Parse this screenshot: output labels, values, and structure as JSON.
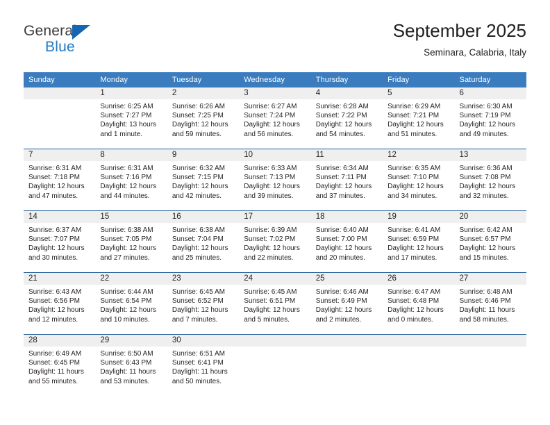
{
  "brand": {
    "name_part1": "General",
    "name_part2": "Blue",
    "accent_color": "#1f7ac4",
    "triangle_color": "#1565b0"
  },
  "header": {
    "title": "September 2025",
    "subtitle": "Seminara, Calabria, Italy"
  },
  "theme": {
    "header_band": "#3a7cbe",
    "row_divider": "#1f5c99",
    "daynum_band": "#efefef",
    "text": "#231f20"
  },
  "weekday_headers": [
    "Sunday",
    "Monday",
    "Tuesday",
    "Wednesday",
    "Thursday",
    "Friday",
    "Saturday"
  ],
  "weeks": [
    [
      {
        "day": "",
        "sunrise": "",
        "sunset": "",
        "daylight_line1": "",
        "daylight_line2": ""
      },
      {
        "day": "1",
        "sunrise": "Sunrise: 6:25 AM",
        "sunset": "Sunset: 7:27 PM",
        "daylight_line1": "Daylight: 13 hours",
        "daylight_line2": "and 1 minute."
      },
      {
        "day": "2",
        "sunrise": "Sunrise: 6:26 AM",
        "sunset": "Sunset: 7:25 PM",
        "daylight_line1": "Daylight: 12 hours",
        "daylight_line2": "and 59 minutes."
      },
      {
        "day": "3",
        "sunrise": "Sunrise: 6:27 AM",
        "sunset": "Sunset: 7:24 PM",
        "daylight_line1": "Daylight: 12 hours",
        "daylight_line2": "and 56 minutes."
      },
      {
        "day": "4",
        "sunrise": "Sunrise: 6:28 AM",
        "sunset": "Sunset: 7:22 PM",
        "daylight_line1": "Daylight: 12 hours",
        "daylight_line2": "and 54 minutes."
      },
      {
        "day": "5",
        "sunrise": "Sunrise: 6:29 AM",
        "sunset": "Sunset: 7:21 PM",
        "daylight_line1": "Daylight: 12 hours",
        "daylight_line2": "and 51 minutes."
      },
      {
        "day": "6",
        "sunrise": "Sunrise: 6:30 AM",
        "sunset": "Sunset: 7:19 PM",
        "daylight_line1": "Daylight: 12 hours",
        "daylight_line2": "and 49 minutes."
      }
    ],
    [
      {
        "day": "7",
        "sunrise": "Sunrise: 6:31 AM",
        "sunset": "Sunset: 7:18 PM",
        "daylight_line1": "Daylight: 12 hours",
        "daylight_line2": "and 47 minutes."
      },
      {
        "day": "8",
        "sunrise": "Sunrise: 6:31 AM",
        "sunset": "Sunset: 7:16 PM",
        "daylight_line1": "Daylight: 12 hours",
        "daylight_line2": "and 44 minutes."
      },
      {
        "day": "9",
        "sunrise": "Sunrise: 6:32 AM",
        "sunset": "Sunset: 7:15 PM",
        "daylight_line1": "Daylight: 12 hours",
        "daylight_line2": "and 42 minutes."
      },
      {
        "day": "10",
        "sunrise": "Sunrise: 6:33 AM",
        "sunset": "Sunset: 7:13 PM",
        "daylight_line1": "Daylight: 12 hours",
        "daylight_line2": "and 39 minutes."
      },
      {
        "day": "11",
        "sunrise": "Sunrise: 6:34 AM",
        "sunset": "Sunset: 7:11 PM",
        "daylight_line1": "Daylight: 12 hours",
        "daylight_line2": "and 37 minutes."
      },
      {
        "day": "12",
        "sunrise": "Sunrise: 6:35 AM",
        "sunset": "Sunset: 7:10 PM",
        "daylight_line1": "Daylight: 12 hours",
        "daylight_line2": "and 34 minutes."
      },
      {
        "day": "13",
        "sunrise": "Sunrise: 6:36 AM",
        "sunset": "Sunset: 7:08 PM",
        "daylight_line1": "Daylight: 12 hours",
        "daylight_line2": "and 32 minutes."
      }
    ],
    [
      {
        "day": "14",
        "sunrise": "Sunrise: 6:37 AM",
        "sunset": "Sunset: 7:07 PM",
        "daylight_line1": "Daylight: 12 hours",
        "daylight_line2": "and 30 minutes."
      },
      {
        "day": "15",
        "sunrise": "Sunrise: 6:38 AM",
        "sunset": "Sunset: 7:05 PM",
        "daylight_line1": "Daylight: 12 hours",
        "daylight_line2": "and 27 minutes."
      },
      {
        "day": "16",
        "sunrise": "Sunrise: 6:38 AM",
        "sunset": "Sunset: 7:04 PM",
        "daylight_line1": "Daylight: 12 hours",
        "daylight_line2": "and 25 minutes."
      },
      {
        "day": "17",
        "sunrise": "Sunrise: 6:39 AM",
        "sunset": "Sunset: 7:02 PM",
        "daylight_line1": "Daylight: 12 hours",
        "daylight_line2": "and 22 minutes."
      },
      {
        "day": "18",
        "sunrise": "Sunrise: 6:40 AM",
        "sunset": "Sunset: 7:00 PM",
        "daylight_line1": "Daylight: 12 hours",
        "daylight_line2": "and 20 minutes."
      },
      {
        "day": "19",
        "sunrise": "Sunrise: 6:41 AM",
        "sunset": "Sunset: 6:59 PM",
        "daylight_line1": "Daylight: 12 hours",
        "daylight_line2": "and 17 minutes."
      },
      {
        "day": "20",
        "sunrise": "Sunrise: 6:42 AM",
        "sunset": "Sunset: 6:57 PM",
        "daylight_line1": "Daylight: 12 hours",
        "daylight_line2": "and 15 minutes."
      }
    ],
    [
      {
        "day": "21",
        "sunrise": "Sunrise: 6:43 AM",
        "sunset": "Sunset: 6:56 PM",
        "daylight_line1": "Daylight: 12 hours",
        "daylight_line2": "and 12 minutes."
      },
      {
        "day": "22",
        "sunrise": "Sunrise: 6:44 AM",
        "sunset": "Sunset: 6:54 PM",
        "daylight_line1": "Daylight: 12 hours",
        "daylight_line2": "and 10 minutes."
      },
      {
        "day": "23",
        "sunrise": "Sunrise: 6:45 AM",
        "sunset": "Sunset: 6:52 PM",
        "daylight_line1": "Daylight: 12 hours",
        "daylight_line2": "and 7 minutes."
      },
      {
        "day": "24",
        "sunrise": "Sunrise: 6:45 AM",
        "sunset": "Sunset: 6:51 PM",
        "daylight_line1": "Daylight: 12 hours",
        "daylight_line2": "and 5 minutes."
      },
      {
        "day": "25",
        "sunrise": "Sunrise: 6:46 AM",
        "sunset": "Sunset: 6:49 PM",
        "daylight_line1": "Daylight: 12 hours",
        "daylight_line2": "and 2 minutes."
      },
      {
        "day": "26",
        "sunrise": "Sunrise: 6:47 AM",
        "sunset": "Sunset: 6:48 PM",
        "daylight_line1": "Daylight: 12 hours",
        "daylight_line2": "and 0 minutes."
      },
      {
        "day": "27",
        "sunrise": "Sunrise: 6:48 AM",
        "sunset": "Sunset: 6:46 PM",
        "daylight_line1": "Daylight: 11 hours",
        "daylight_line2": "and 58 minutes."
      }
    ],
    [
      {
        "day": "28",
        "sunrise": "Sunrise: 6:49 AM",
        "sunset": "Sunset: 6:45 PM",
        "daylight_line1": "Daylight: 11 hours",
        "daylight_line2": "and 55 minutes."
      },
      {
        "day": "29",
        "sunrise": "Sunrise: 6:50 AM",
        "sunset": "Sunset: 6:43 PM",
        "daylight_line1": "Daylight: 11 hours",
        "daylight_line2": "and 53 minutes."
      },
      {
        "day": "30",
        "sunrise": "Sunrise: 6:51 AM",
        "sunset": "Sunset: 6:41 PM",
        "daylight_line1": "Daylight: 11 hours",
        "daylight_line2": "and 50 minutes."
      },
      {
        "day": "",
        "sunrise": "",
        "sunset": "",
        "daylight_line1": "",
        "daylight_line2": ""
      },
      {
        "day": "",
        "sunrise": "",
        "sunset": "",
        "daylight_line1": "",
        "daylight_line2": ""
      },
      {
        "day": "",
        "sunrise": "",
        "sunset": "",
        "daylight_line1": "",
        "daylight_line2": ""
      },
      {
        "day": "",
        "sunrise": "",
        "sunset": "",
        "daylight_line1": "",
        "daylight_line2": ""
      }
    ]
  ]
}
